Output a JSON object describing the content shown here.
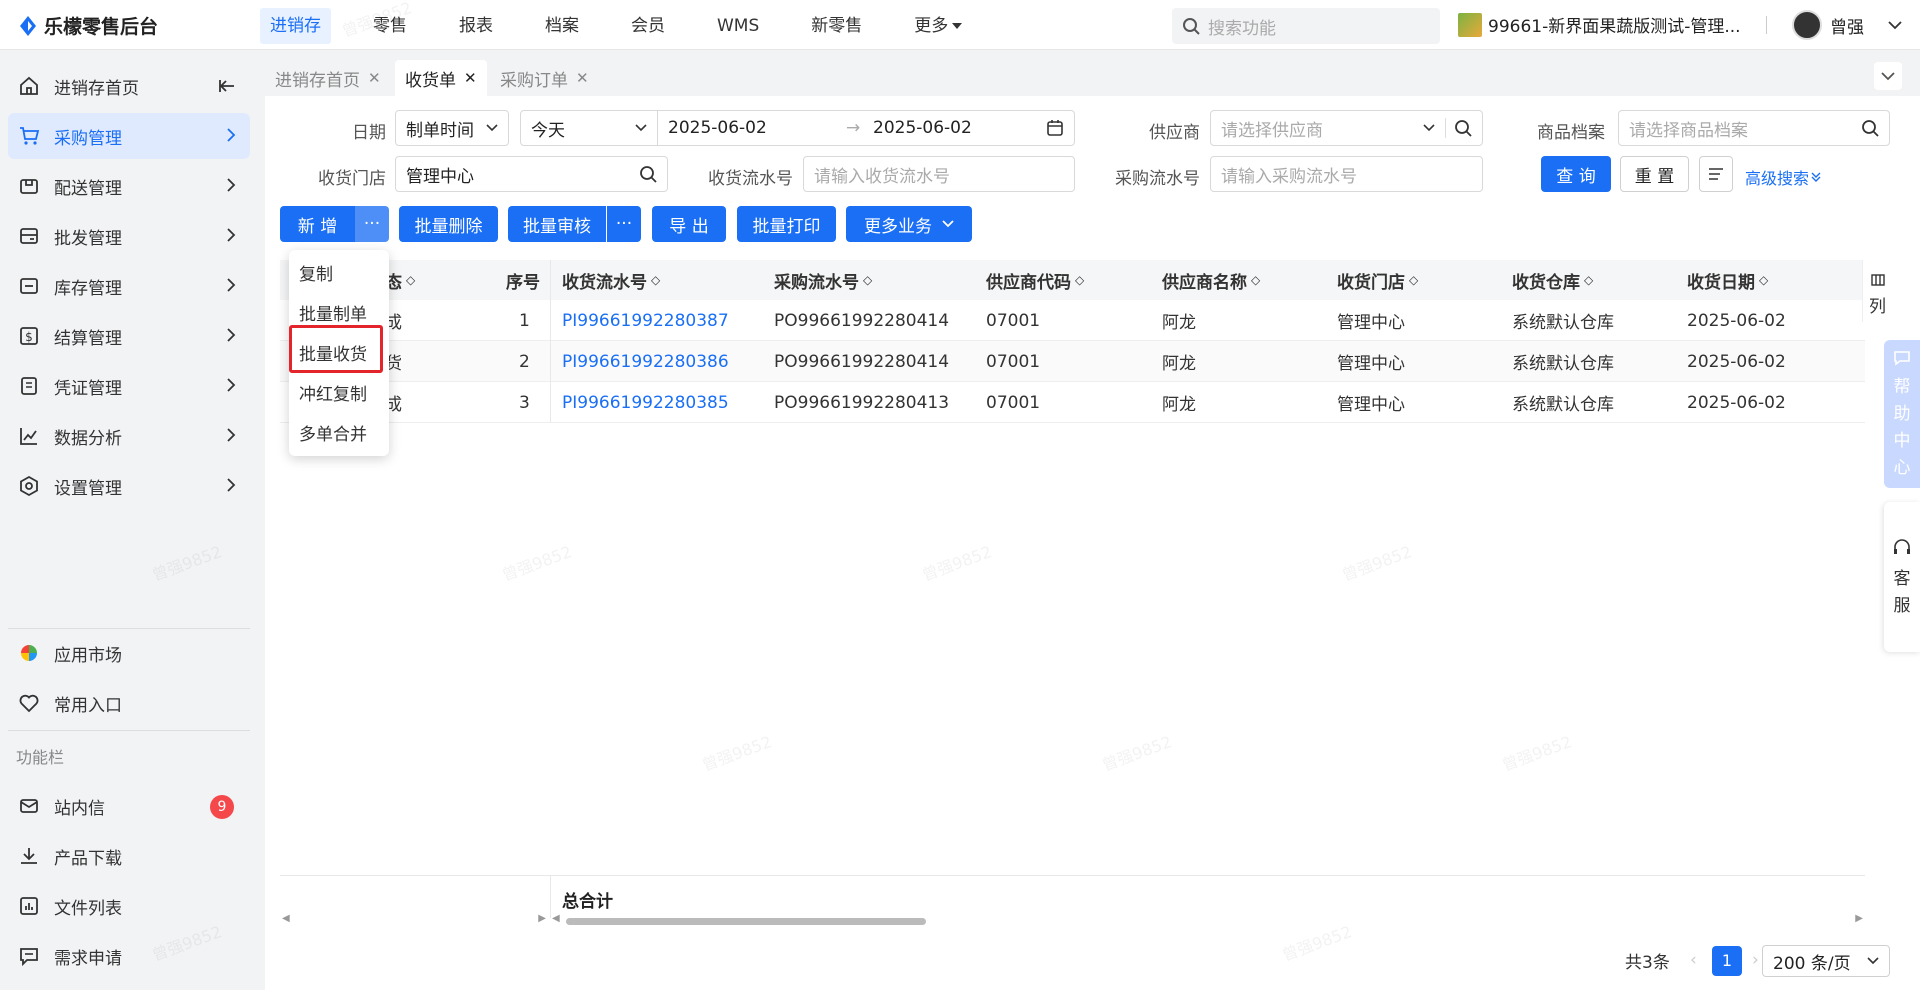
{
  "app": {
    "name": "乐檬零售后台"
  },
  "topnav": {
    "items": [
      "进销存",
      "零售",
      "报表",
      "档案",
      "会员",
      "WMS",
      "新零售",
      "更多"
    ]
  },
  "global_search": {
    "placeholder": "搜索功能"
  },
  "store": {
    "name": "99661-新界面果蔬版测试-管理..."
  },
  "user": {
    "name": "曾强"
  },
  "sidebar": {
    "items": [
      {
        "label": "进销存首页"
      },
      {
        "label": "采购管理"
      },
      {
        "label": "配送管理"
      },
      {
        "label": "批发管理"
      },
      {
        "label": "库存管理"
      },
      {
        "label": "结算管理"
      },
      {
        "label": "凭证管理"
      },
      {
        "label": "数据分析"
      },
      {
        "label": "设置管理"
      }
    ],
    "bottom": [
      {
        "label": "应用市场"
      },
      {
        "label": "常用入口"
      }
    ],
    "section_label": "功能栏",
    "tools": [
      {
        "label": "站内信",
        "badge": "9"
      },
      {
        "label": "产品下载"
      },
      {
        "label": "文件列表"
      },
      {
        "label": "需求申请"
      }
    ]
  },
  "tabs": [
    "进销存首页",
    "收货单",
    "采购订单"
  ],
  "filters": {
    "date_label": "日期",
    "date_type": "制单时间",
    "date_range": "今天",
    "date_start": "2025-06-02",
    "date_end": "2025-06-02",
    "supplier_label": "供应商",
    "supplier_placeholder": "请选择供应商",
    "product_label": "商品档案",
    "product_placeholder": "请选择商品档案",
    "store_label": "收货门店",
    "store_value": "管理中心",
    "receipt_no_label": "收货流水号",
    "receipt_no_placeholder": "请输入收货流水号",
    "po_no_label": "采购流水号",
    "po_no_placeholder": "请输入采购流水号",
    "query": "查 询",
    "reset": "重 置",
    "advanced": "高级搜索"
  },
  "toolbar": {
    "add": "新 增",
    "more": "···",
    "batch_delete": "批量删除",
    "batch_audit": "批量审核",
    "export": "导 出",
    "batch_print": "批量打印",
    "more_business": "更多业务"
  },
  "dropdown": [
    "复制",
    "批量制单",
    "批量收货",
    "冲红复制",
    "多单合并"
  ],
  "table": {
    "columns": [
      "态",
      "序号",
      "收货流水号",
      "采购流水号",
      "供应商代码",
      "供应商名称",
      "收货门店",
      "收货仓库",
      "收货日期"
    ],
    "rows": [
      {
        "status": "成",
        "seq": "1",
        "receipt_no": "PI99661992280387",
        "po_no": "PO99661992280414",
        "supplier_code": "07001",
        "supplier_name": "阿龙",
        "store": "管理中心",
        "warehouse": "系统默认仓库",
        "date": "2025-06-02"
      },
      {
        "status": "货",
        "seq": "2",
        "receipt_no": "PI99661992280386",
        "po_no": "PO99661992280414",
        "supplier_code": "07001",
        "supplier_name": "阿龙",
        "store": "管理中心",
        "warehouse": "系统默认仓库",
        "date": "2025-06-02"
      },
      {
        "status": "成",
        "seq": "3",
        "receipt_no": "PI99661992280385",
        "po_no": "PO99661992280413",
        "supplier_code": "07001",
        "supplier_name": "阿龙",
        "store": "管理中心",
        "warehouse": "系统默认仓库",
        "date": "2025-06-02"
      }
    ],
    "total_label": "总合计",
    "column_setting": "列"
  },
  "pagination": {
    "total": "共3条",
    "current": "1",
    "page_size": "200 条/页"
  },
  "float": {
    "help": [
      "帮",
      "助",
      "中",
      "心"
    ],
    "service": [
      "客",
      "服"
    ]
  },
  "watermark": "曾强9852",
  "colors": {
    "primary": "#1a6ff5",
    "highlight": "#e3242b",
    "badge": "#f5484a"
  }
}
